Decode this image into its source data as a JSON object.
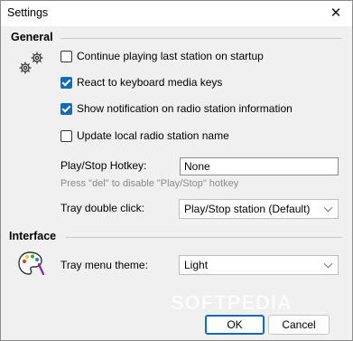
{
  "window": {
    "title": "Settings",
    "close_glyph": "✕"
  },
  "general": {
    "heading": "General",
    "icon": "gears-icon",
    "options": [
      {
        "label": "Continue playing last station on startup",
        "checked": false
      },
      {
        "label": "React to keyboard media keys",
        "checked": true
      },
      {
        "label": "Show notification on radio station information",
        "checked": true
      },
      {
        "label": "Update local radio station name",
        "checked": false
      }
    ],
    "hotkey_label": "Play/Stop Hotkey:",
    "hotkey_value": "None",
    "hotkey_hint": "Press \"del\" to disable \"Play/Stop\" hotkey",
    "dblclick_label": "Tray double click:",
    "dblclick_value": "Play/Stop station (Default)"
  },
  "interface": {
    "heading": "Interface",
    "icon": "palette-icon",
    "theme_label": "Tray menu theme:",
    "theme_value": "Light"
  },
  "buttons": {
    "ok": "OK",
    "cancel": "Cancel"
  },
  "watermark": "SOFTPEDIA",
  "colors": {
    "accent": "#0f6cbd"
  }
}
